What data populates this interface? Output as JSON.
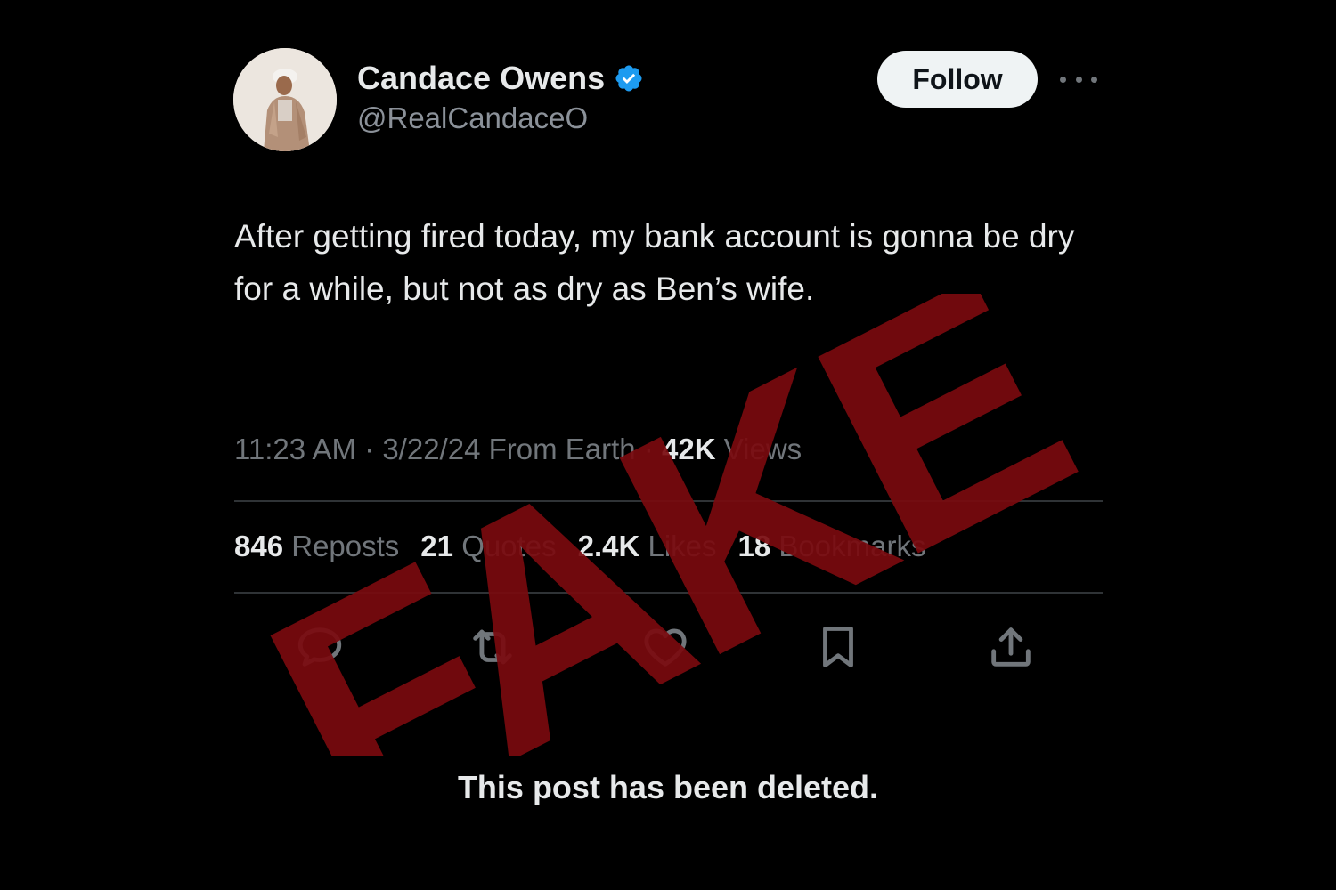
{
  "user": {
    "display_name": "Candace Owens",
    "handle": "@RealCandaceO",
    "verified": true
  },
  "header": {
    "follow_label": "Follow",
    "more_icon": "ellipsis-icon"
  },
  "tweet": {
    "text": "After getting fired today, my bank account is gonna be dry for a while, but not as dry as Ben’s wife."
  },
  "meta": {
    "time": "11:23 AM",
    "date": "3/22/24",
    "source": "From Earth",
    "views_count": "42K",
    "views_label": "Views",
    "separator": "·"
  },
  "stats": [
    {
      "count": "846",
      "label": "Reposts"
    },
    {
      "count": "21",
      "label": "Quotes"
    },
    {
      "count": "2.4K",
      "label": "Likes"
    },
    {
      "count": "18",
      "label": "Bookmarks"
    }
  ],
  "actions": [
    "reply-icon",
    "repost-icon",
    "like-icon",
    "bookmark-icon",
    "share-icon"
  ],
  "stamp": {
    "text": "FAKE",
    "color": "#7a0a0e"
  },
  "notice": "This post has been deleted.",
  "colors": {
    "background": "#000000",
    "text": "#e7e9ea",
    "muted": "#71767b",
    "verified": "#1d9bf0",
    "divider": "#2f3336"
  }
}
